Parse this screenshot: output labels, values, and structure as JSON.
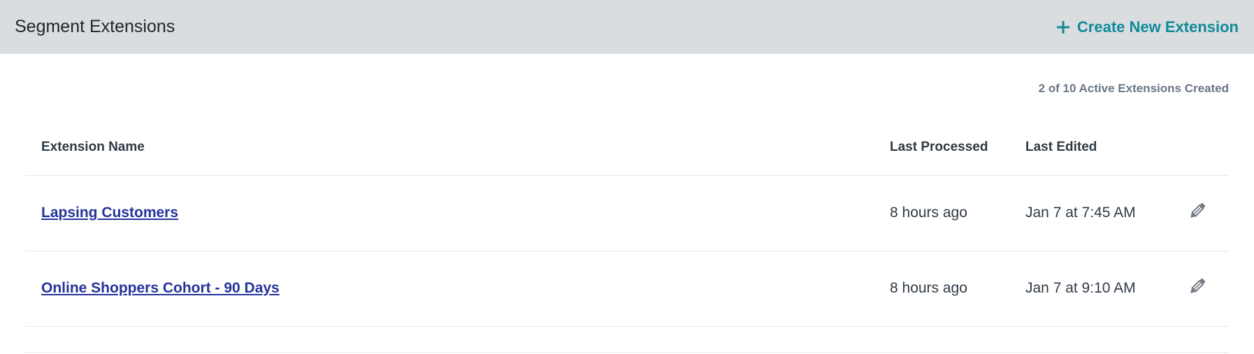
{
  "header": {
    "title": "Segment Extensions",
    "create_label": "Create New Extension",
    "create_icon": "plus-icon",
    "accent_color": "#0f8a98"
  },
  "summary": {
    "count_text": "2 of 10 Active Extensions Created"
  },
  "table": {
    "columns": {
      "name": "Extension Name",
      "last_processed": "Last Processed",
      "last_edited": "Last Edited"
    },
    "rows": [
      {
        "name": "Lapsing Customers",
        "last_processed": "8 hours ago",
        "last_edited": "Jan 7 at 7:45 AM",
        "action_icon": "pencil-icon"
      },
      {
        "name": "Online Shoppers Cohort - 90 Days",
        "last_processed": "8 hours ago",
        "last_edited": "Jan 7 at 9:10 AM",
        "action_icon": "pencil-icon"
      }
    ]
  }
}
